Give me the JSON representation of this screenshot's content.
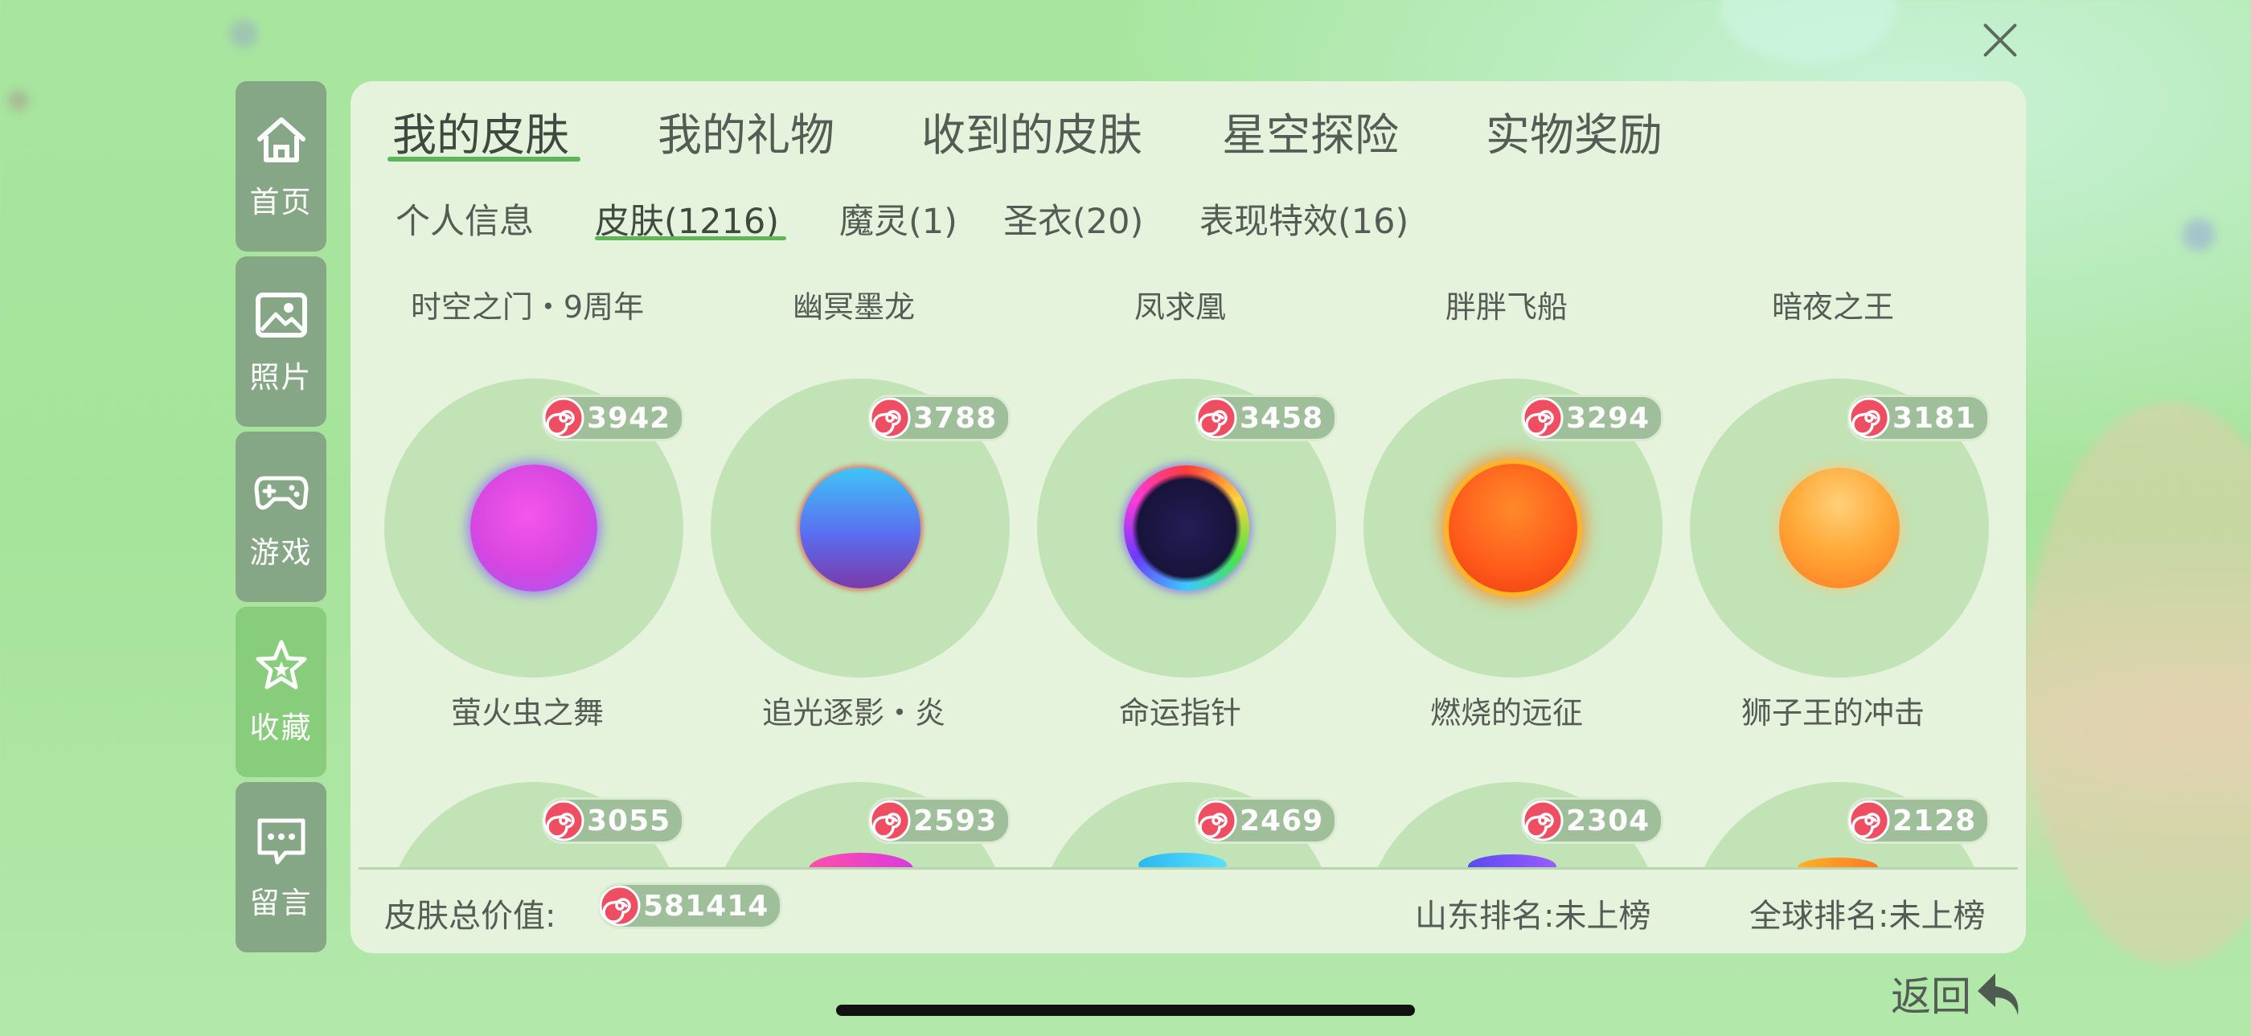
{
  "close": {
    "icon": "close-icon"
  },
  "sidebar": {
    "items": [
      {
        "label": "首页",
        "icon": "home-icon",
        "active": false
      },
      {
        "label": "照片",
        "icon": "photo-icon",
        "active": false
      },
      {
        "label": "游戏",
        "icon": "gamepad-icon",
        "active": false
      },
      {
        "label": "收藏",
        "icon": "star-icon",
        "active": true
      },
      {
        "label": "留言",
        "icon": "message-icon",
        "active": false
      }
    ]
  },
  "tabs": [
    "我的皮肤",
    "我的礼物",
    "收到的皮肤",
    "星空探险",
    "实物奖励"
  ],
  "active_tab": "我的皮肤",
  "subtabs": [
    "个人信息",
    "皮肤(1216)",
    "魔灵(1)",
    "圣衣(20)",
    "表现特效(16)"
  ],
  "active_subtab": "皮肤(1216)",
  "skins_row1": [
    {
      "title": "时空之门・9周年",
      "name": "萤火虫之舞",
      "price": "3942",
      "orb_color": "#e24bd8"
    },
    {
      "title": "幽冥墨龙",
      "name": "追光逐影・炎",
      "price": "3788",
      "orb_color": "#4d7df0"
    },
    {
      "title": "凤求凰",
      "name": "命运指针",
      "price": "3458",
      "orb_color": "#1d1b4a"
    },
    {
      "title": "胖胖飞船",
      "name": "燃烧的远征",
      "price": "3294",
      "orb_color": "#ff5a1a"
    },
    {
      "title": "暗夜之王",
      "name": "狮子王的冲击",
      "price": "3181",
      "orb_color": "#ff9a2e"
    }
  ],
  "skins_row2": [
    {
      "price": "3055"
    },
    {
      "price": "2593"
    },
    {
      "price": "2469"
    },
    {
      "price": "2304"
    },
    {
      "price": "2128"
    }
  ],
  "footer": {
    "total_label": "皮肤总价值:",
    "total_value": "581414",
    "region_rank": "山东排名:未上榜",
    "global_rank": "全球排名:未上榜"
  },
  "back": {
    "label": "返回",
    "icon": "back-arrow-icon"
  }
}
